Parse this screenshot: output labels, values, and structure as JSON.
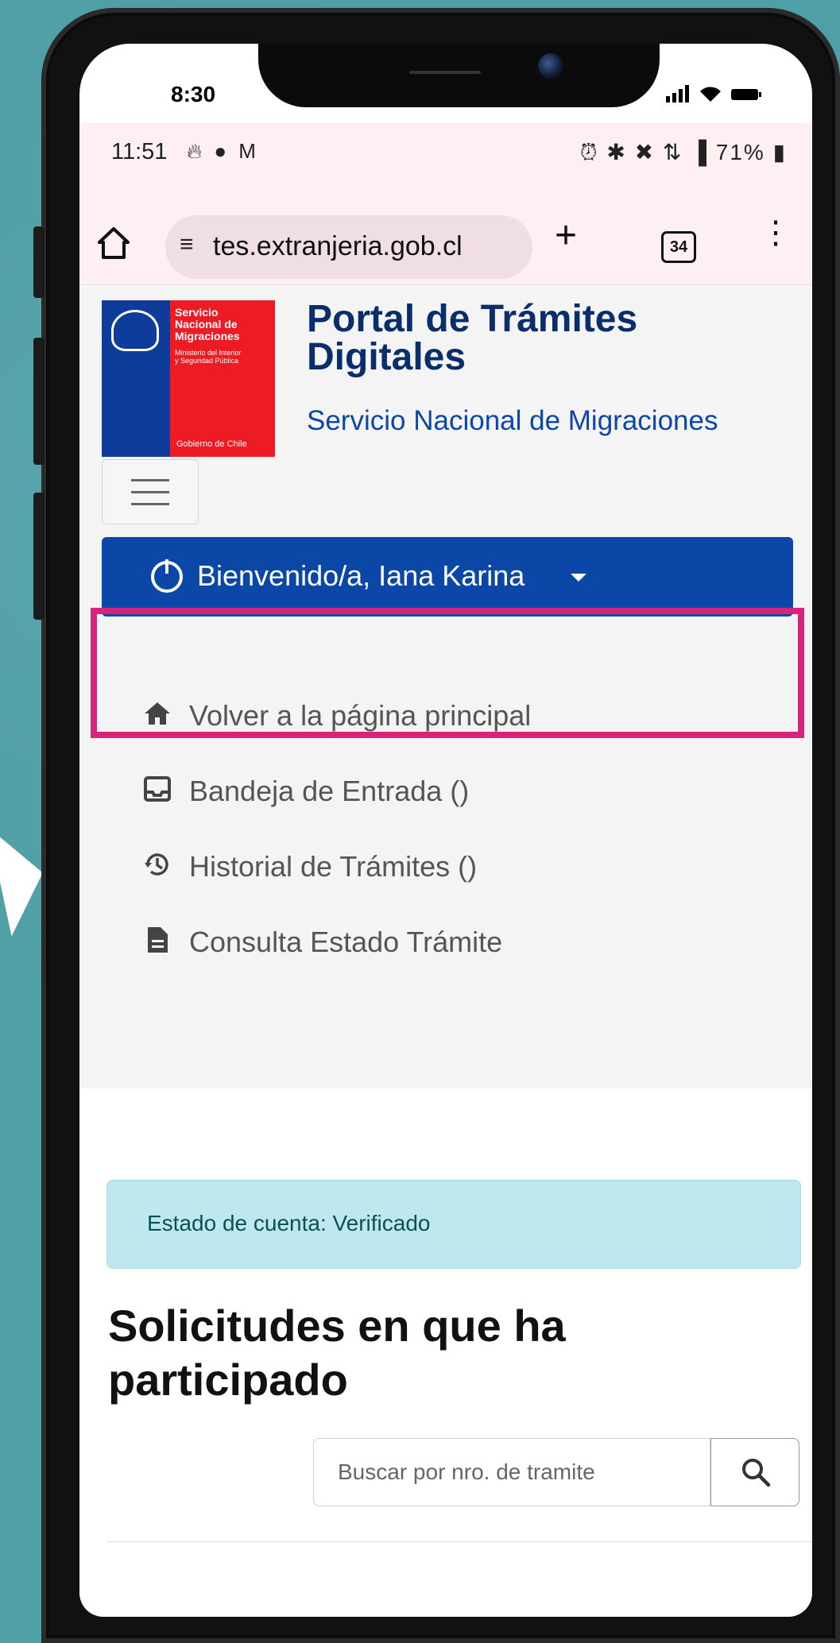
{
  "ios_status": {
    "time": "8:30"
  },
  "android_status": {
    "time": "11:51",
    "battery": "71%"
  },
  "browser": {
    "url": "tes.extranjeria.gob.cl",
    "tab_count": "34"
  },
  "logo": {
    "line1": "Servicio",
    "line2": "Nacional de",
    "line3": "Migraciones",
    "ministry1": "Ministerio del Interior",
    "ministry2": "y Seguridad Pública",
    "gov": "Gobierno de Chile"
  },
  "header": {
    "title": "Portal de Trámites Digitales",
    "subtitle": "Servicio Nacional de Migraciones"
  },
  "user_menu": {
    "label": "Bienvenido/a, Iana Karina"
  },
  "nav": [
    {
      "label": "Volver a la página principal",
      "icon": "home-icon"
    },
    {
      "label": "Bandeja de Entrada ()",
      "icon": "inbox-icon"
    },
    {
      "label": "Historial de Trámites ()",
      "icon": "history-icon"
    },
    {
      "label": "Consulta Estado Trámite",
      "icon": "document-icon"
    }
  ],
  "account": {
    "status": "Estado de cuenta: Verificado"
  },
  "main": {
    "heading": "Solicitudes en que ha participado"
  },
  "search": {
    "placeholder": "Buscar por nro. de tramite"
  },
  "colors": {
    "primary": "#0b47a6",
    "highlight": "#d6247b",
    "alert_bg": "#bfe8ee"
  }
}
